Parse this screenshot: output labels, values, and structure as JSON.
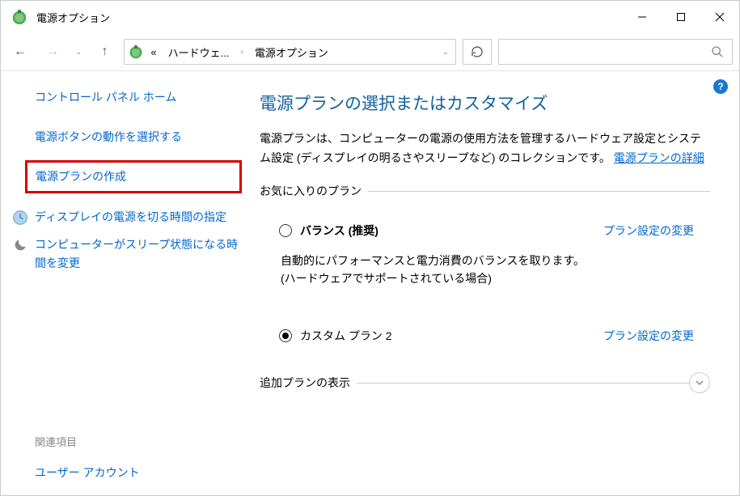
{
  "window": {
    "title": "電源オプション"
  },
  "breadcrumb": {
    "prefix": "«",
    "item1": "ハードウェ...",
    "item2": "電源オプション"
  },
  "sidebar": {
    "home": "コントロール パネル ホーム",
    "link1": "電源ボタンの動作を選択する",
    "link2": "電源プランの作成",
    "link3": "ディスプレイの電源を切る時間の指定",
    "link4": "コンピューターがスリープ状態になる時間を変更",
    "related_label": "関連項目",
    "related1": "ユーザー アカウント"
  },
  "main": {
    "title": "電源プランの選択またはカスタマイズ",
    "desc_before": "電源プランは、コンピューターの電源の使用方法を管理するハードウェア設定とシステム設定 (ディスプレイの明るさやスリープなど) のコレクションです。",
    "desc_link": "電源プランの詳細",
    "favorite_legend": "お気に入りのプラン",
    "additional_legend": "追加プランの表示",
    "plans": [
      {
        "name": "バランス (推奨)",
        "desc": "自動的にパフォーマンスと電力消費のバランスを取ります。(ハードウェアでサポートされている場合)",
        "link": "プラン設定の変更",
        "selected": false
      },
      {
        "name": "カスタム プラン 2",
        "desc": "",
        "link": "プラン設定の変更",
        "selected": true
      }
    ]
  }
}
